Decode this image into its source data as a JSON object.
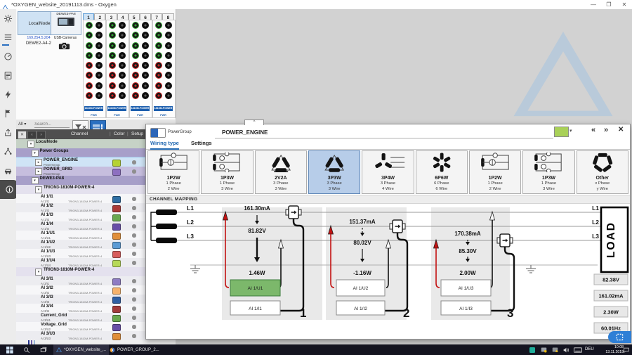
{
  "window": {
    "title": "*OXYGEN_website_20191113.dms - Oxygen"
  },
  "sidebar": {
    "items": [
      {
        "name": "settings",
        "icon": "gear",
        "active": false
      },
      {
        "name": "channel-list",
        "icon": "list",
        "active": true
      },
      {
        "name": "measurement",
        "icon": "gauge",
        "active": false
      },
      {
        "name": "screens",
        "icon": "report",
        "active": false
      },
      {
        "name": "trigger",
        "icon": "bolt",
        "active": false
      },
      {
        "name": "events",
        "icon": "flag",
        "active": false
      },
      {
        "name": "export",
        "icon": "share",
        "active": false
      },
      {
        "name": "network",
        "icon": "nodes",
        "active": false
      },
      {
        "name": "vehicle",
        "icon": "car",
        "active": false
      },
      {
        "name": "system-info",
        "icon": "info",
        "active": false,
        "dark": true
      }
    ]
  },
  "devices": {
    "local_node": {
      "title": "LocalNode",
      "ip": "169.254.5.204",
      "name": "DEWE2-A4-2"
    },
    "remote": {
      "title": "DEWE3-PA8",
      "sub": "USB-Cameras"
    }
  },
  "channel_grid": {
    "columns": [
      "1",
      "2",
      "3",
      "4",
      "5",
      "6",
      "7",
      "8"
    ],
    "selected_column": "1",
    "groups": 4,
    "rows": 8,
    "green_rows": 4,
    "module_label": "1810M-POWER",
    "module_sub": "PWR",
    "colors": {
      "green": "#2f9e2f",
      "red": "#cc2222",
      "black": "#1a1a1a"
    }
  },
  "channel_panel": {
    "filter_label": "All",
    "search_placeholder": "Search...",
    "columns": {
      "channel": "Channel",
      "color": "Color",
      "setup": "Setup"
    },
    "tree": [
      {
        "kind": "node",
        "label": "LocalNode",
        "bg": "#c6d2c6",
        "indent": 0
      },
      {
        "kind": "node",
        "label": "Power Groups",
        "bg": "#a79fc9",
        "indent": 1
      },
      {
        "kind": "chan",
        "label": "POWER_ENGINE",
        "sub": "PowerGroup",
        "chip": "#b5d233",
        "bg": "#cfe4f6",
        "indent": 2,
        "selected": true
      },
      {
        "kind": "chan",
        "label": "POWER_GRID",
        "sub": "PowerGroup",
        "chip": "#8d6fc0",
        "bg": "#c6bede",
        "indent": 2
      },
      {
        "kind": "node",
        "label": "DEWE3-PA8",
        "bg": "#a79fc9",
        "indent": 1
      },
      {
        "kind": "node",
        "label": "TRION3-1810M-POWER-4",
        "bg": "#e4e1ee",
        "indent": 2
      },
      {
        "kind": "chan",
        "label": "AI 1/I1",
        "sub": "AI 1/I1",
        "mod": "TRION3-1810M-POWER-4",
        "chip": "#2e6da4",
        "indent": 3
      },
      {
        "kind": "chan",
        "label": "AI 1/I2",
        "sub": "AI 1/I2",
        "mod": "TRION3-1810M-POWER-4",
        "chip": "#a93a38",
        "indent": 3
      },
      {
        "kind": "chan",
        "label": "AI 1/I3",
        "sub": "AI 1/I3",
        "mod": "TRION3-1810M-POWER-4",
        "chip": "#69a84f",
        "indent": 3
      },
      {
        "kind": "chan",
        "label": "AI 1/I4",
        "sub": "AI 1/I4",
        "mod": "TRION3-1810M-POWER-4",
        "chip": "#674ea7",
        "indent": 3
      },
      {
        "kind": "chan",
        "label": "AI 1/U1",
        "sub": "AI 1/U1",
        "mod": "TRION3-1810M-POWER-4",
        "chip": "#e08e39",
        "indent": 3
      },
      {
        "kind": "chan",
        "label": "AI 1/U2",
        "sub": "AI 1/U2",
        "mod": "TRION3-1810M-POWER-4",
        "chip": "#5b9bd5",
        "indent": 3
      },
      {
        "kind": "chan",
        "label": "AI 1/U3",
        "sub": "AI 1/U3",
        "mod": "TRION3-1810M-POWER-4",
        "chip": "#d65c5c",
        "indent": 3
      },
      {
        "kind": "chan",
        "label": "AI 1/U4",
        "sub": "AI 1/U4",
        "mod": "TRION3-1810M-POWER-4",
        "chip": "#b6d957",
        "indent": 3
      },
      {
        "kind": "node",
        "label": "TRION3-1810M-POWER-4",
        "bg": "#e4e1ee",
        "indent": 2
      },
      {
        "kind": "chan",
        "label": "AI 3/I1",
        "sub": "AI 3/I1",
        "mod": "TRION3-1810M-POWER-4",
        "chip": "#8e7cc3",
        "indent": 3
      },
      {
        "kind": "chan",
        "label": "AI 3/I2",
        "sub": "AI 3/I2",
        "mod": "TRION3-1810M-POWER-4",
        "chip": "#f6b26b",
        "indent": 3
      },
      {
        "kind": "chan",
        "label": "AI 3/I3",
        "sub": "AI 3/I3",
        "mod": "TRION3-1810M-POWER-4",
        "chip": "#2e5fa3",
        "indent": 3
      },
      {
        "kind": "chan",
        "label": "AI 3/I4",
        "sub": "AI 3/I4",
        "mod": "TRION3-1810M-POWER-4",
        "chip": "#a23b3b",
        "indent": 3
      },
      {
        "kind": "chan",
        "label": "Current_Grid",
        "sub": "AI 3/U1",
        "mod": "TRION3-1810M-POWER-4",
        "chip": "#69a84f",
        "indent": 3
      },
      {
        "kind": "chan",
        "label": "Voltage_Grid",
        "sub": "AI 3/U2",
        "mod": "TRION3-1810M-POWER-4",
        "chip": "#674ea7",
        "indent": 3
      },
      {
        "kind": "chan",
        "label": "AI 3/U3",
        "sub": "AI 3/U3",
        "mod": "TRION3-1810M-POWER-4",
        "chip": "#e08e39",
        "indent": 3
      }
    ]
  },
  "dialog": {
    "type_label": "PowerGroup",
    "name_value": "POWER_ENGINE",
    "color": "#a9d158",
    "nav": {
      "prev": "«",
      "next": "»",
      "close": "✕",
      "collapse": "^",
      "color_dd": "▾"
    },
    "tabs": [
      {
        "label": "Wiring type",
        "active": true
      },
      {
        "label": "Settings",
        "active": false
      }
    ],
    "wiring_types": [
      {
        "code": "1P2W",
        "phase": "1 Phase",
        "wire": "2 Wire",
        "icon": "single",
        "selected": false
      },
      {
        "code": "1P3W",
        "phase": "1 Phase",
        "wire": "3 Wire",
        "icon": "single3",
        "selected": false
      },
      {
        "code": "2V2A",
        "phase": "3 Phase",
        "wire": "3 Wire",
        "icon": "delta2",
        "selected": false
      },
      {
        "code": "3P3W",
        "phase": "3 Phase",
        "wire": "3 Wire",
        "icon": "delta",
        "selected": true
      },
      {
        "code": "3P4W",
        "phase": "3 Phase",
        "wire": "4 Wire",
        "icon": "wye",
        "selected": false
      },
      {
        "code": "6P6W",
        "phase": "6 Phase",
        "wire": "6 Wire",
        "icon": "star6",
        "selected": false
      },
      {
        "code": "1P2W",
        "phase": "1 Phase",
        "wire": "2 Wire",
        "icon": "single",
        "selected": false
      },
      {
        "code": "1P3W",
        "phase": "1 Phase",
        "wire": "3 Wire",
        "icon": "single3",
        "selected": false
      },
      {
        "code": "Other",
        "phase": "x Phase",
        "wire": "y Wire",
        "icon": "poly",
        "selected": false
      }
    ],
    "mapping": {
      "section_label": "CHANNEL MAPPING",
      "lines": [
        "L1",
        "L2",
        "L3"
      ],
      "load_label": "LOAD",
      "phases": [
        {
          "number": "1",
          "current": "161.30mA",
          "voltage": "81.82V",
          "power": "1.46W",
          "u_channel": "AI 1/U1",
          "i_channel": "AI 1/I1",
          "u_selected": true
        },
        {
          "number": "2",
          "current": "151.37mA",
          "voltage": "80.02V",
          "power": "-1.16W",
          "u_channel": "AI 1/U2",
          "i_channel": "AI 1/I2",
          "u_selected": false
        },
        {
          "number": "3",
          "current": "170.38mA",
          "voltage": "85.30V",
          "power": "2.00W",
          "u_channel": "AI 1/U3",
          "i_channel": "AI 1/I3",
          "u_selected": false
        }
      ],
      "totals": [
        "82.38V",
        "161.02mA",
        "2.30W",
        "60.01Hz"
      ],
      "colors": {
        "u_selected": "#7cb86b",
        "phase_panel": "#e9e9e9",
        "probe_red": "#c41212"
      }
    }
  },
  "taskbar": {
    "apps": [
      {
        "label": "*OXYGEN_website_...",
        "icon": "oxygen-logo",
        "active": true
      },
      {
        "label": "POWER_GROUP_2...",
        "icon": "power-group-doc",
        "active": false
      }
    ],
    "tray": {
      "lang": "DEU",
      "time": "10:08",
      "date": "13.11.2019"
    }
  }
}
